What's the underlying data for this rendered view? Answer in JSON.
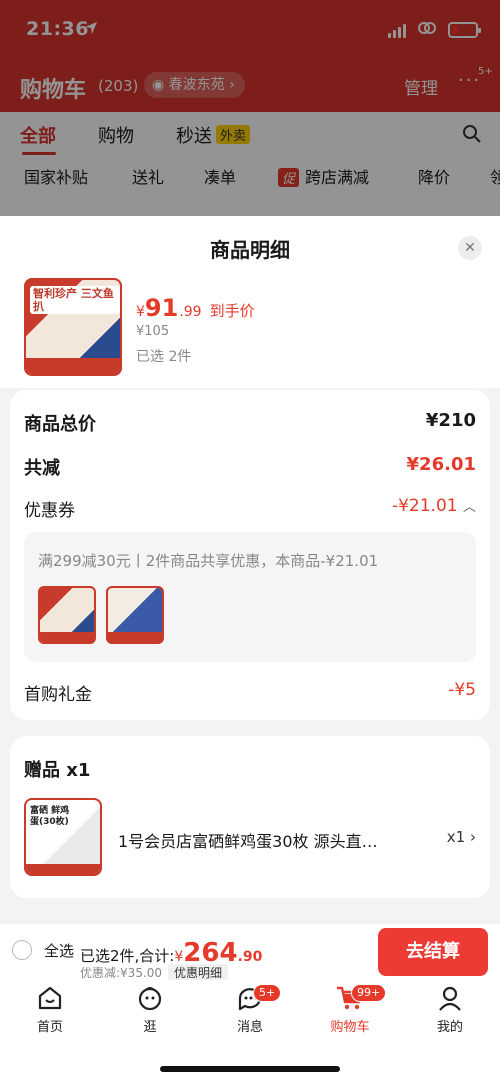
{
  "status_bar": {
    "time": "21:36"
  },
  "page_header": {
    "title": "购物车",
    "count": "(203)",
    "location": "春波东苑",
    "manage": "管理",
    "more_badge": "5+"
  },
  "main_tabs": [
    {
      "label": "全部"
    },
    {
      "label": "购物"
    },
    {
      "label": "秒送",
      "badge": "外卖"
    }
  ],
  "filter_chips": [
    "国家补贴",
    "送礼",
    "凑单",
    "跨店满减",
    "降价",
    "领"
  ],
  "promo_mark": "促",
  "sheet": {
    "title": "商品明细",
    "product": {
      "thumb_text": "智利珍产 三文鱼扒",
      "price_symbol": "¥",
      "price_int": "91",
      "price_dec": ".99",
      "price_tag": "到手价",
      "original_price": "¥105",
      "selected": "已选 2件"
    },
    "rows": {
      "total_label": "商品总价",
      "total_value": "¥210",
      "discount_label": "共减",
      "discount_value": "¥26.01",
      "coupon_label": "优惠券",
      "coupon_value": "-¥21.01",
      "coupon_desc": "满299减30元丨2件商品共享优惠，本商品-¥21.01",
      "firstbuy_label": "首购礼金",
      "firstbuy_value": "-¥5"
    },
    "gift": {
      "title": "赠品 x1",
      "thumb_text": "富硒 鲜鸡蛋(30枚)",
      "name": "1号会员店富硒鲜鸡蛋30枚 源头直…",
      "qty": "x1"
    }
  },
  "checkout": {
    "select_all": "全选",
    "summary": "已选2件,合计:",
    "total_symbol": "¥",
    "total_int": "264",
    "total_dec": ".90",
    "discount": "优惠减:¥35.00",
    "detail_link": "优惠明细",
    "pay_button": "去结算"
  },
  "bottom_nav": [
    {
      "label": "首页",
      "icon": "home-icon"
    },
    {
      "label": "逛",
      "icon": "explore-icon"
    },
    {
      "label": "消息",
      "icon": "message-icon",
      "badge": "5+"
    },
    {
      "label": "购物车",
      "icon": "cart-icon",
      "badge": "99+",
      "active": true
    },
    {
      "label": "我的",
      "icon": "profile-icon"
    }
  ],
  "colors": {
    "brand_red": "#d8352e",
    "accent": "#e5392a",
    "pay_button": "#ee3a34"
  }
}
